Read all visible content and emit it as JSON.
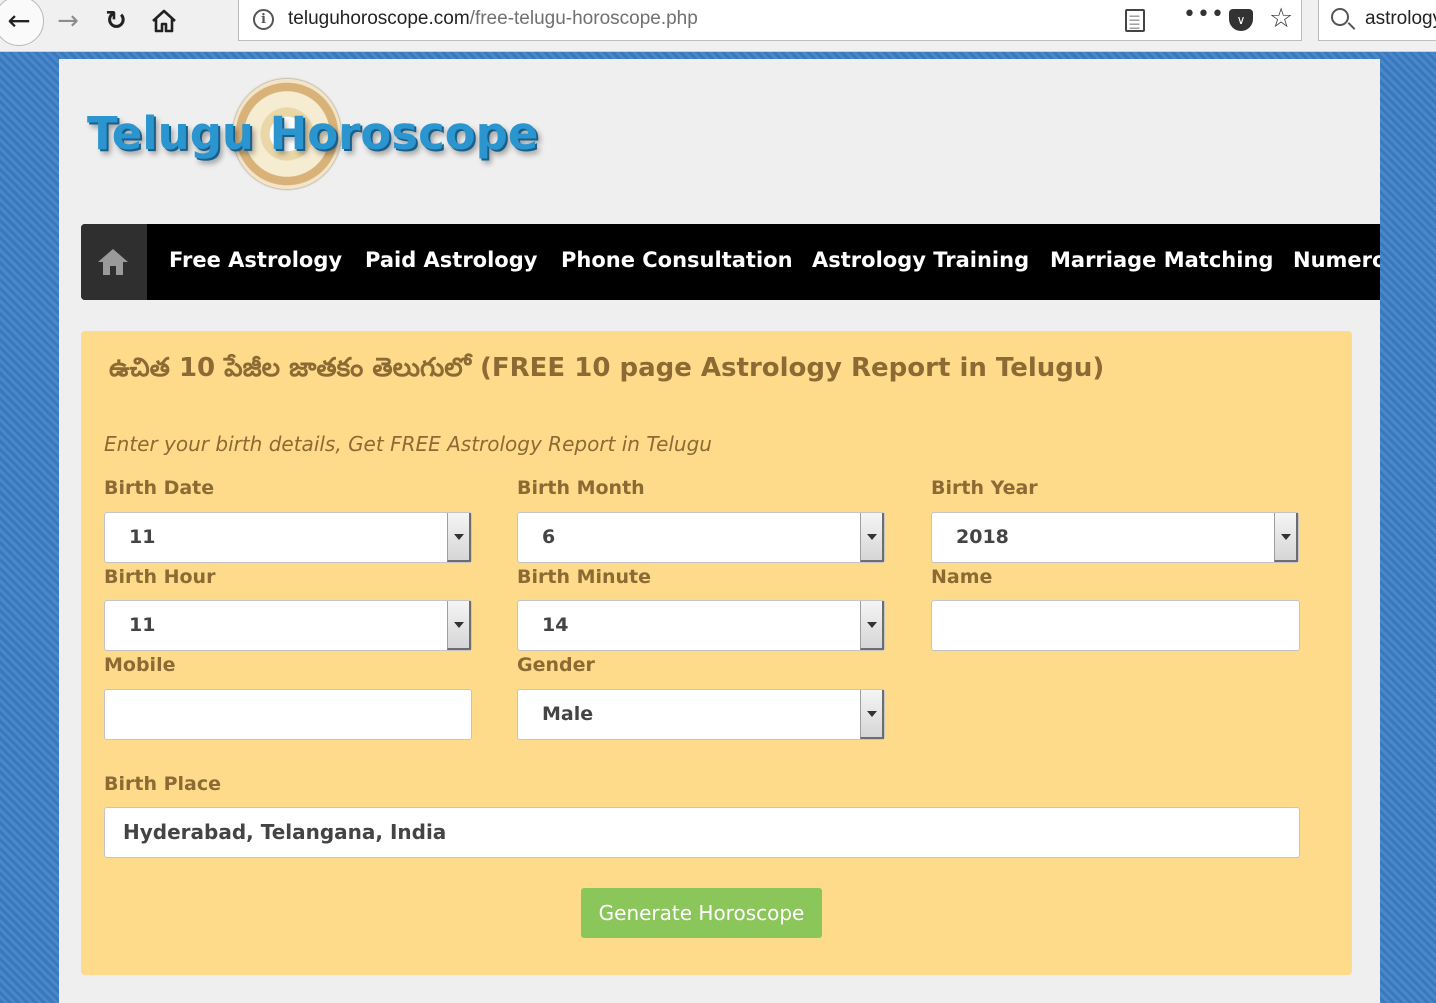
{
  "browser": {
    "url_domain": "teluguhoroscope.com",
    "url_path": "/free-telugu-horoscope.php",
    "search_value": "astrology"
  },
  "site": {
    "logo_text": "Telugu Horoscope"
  },
  "nav": {
    "items": [
      "Free Astrology",
      "Paid Astrology",
      "Phone Consultation",
      "Astrology Training",
      "Marriage Matching",
      "Numerology"
    ]
  },
  "form": {
    "title": "ఉచిత 10 పేజీల జాతకం తెలుగులో (FREE 10 page Astrology Report in Telugu)",
    "subtitle": "Enter your birth details, Get FREE Astrology Report in Telugu",
    "birth_date": {
      "label": "Birth Date",
      "value": "11"
    },
    "birth_month": {
      "label": "Birth Month",
      "value": "6"
    },
    "birth_year": {
      "label": "Birth Year",
      "value": "2018"
    },
    "birth_hour": {
      "label": "Birth Hour",
      "value": "11"
    },
    "birth_minute": {
      "label": "Birth Minute",
      "value": "14"
    },
    "name": {
      "label": "Name",
      "value": ""
    },
    "mobile": {
      "label": "Mobile",
      "value": ""
    },
    "gender": {
      "label": "Gender",
      "value": "Male"
    },
    "birth_place": {
      "label": "Birth Place",
      "value": "Hyderabad, Telangana, India"
    },
    "submit_label": "Generate Horoscope"
  }
}
